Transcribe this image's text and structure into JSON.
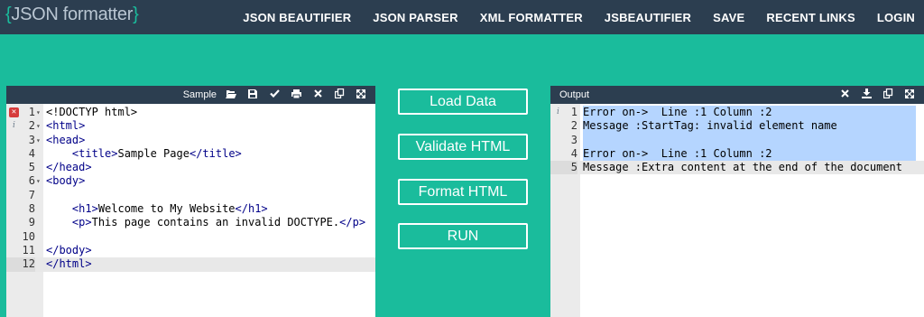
{
  "brand": {
    "open": "{",
    "name": "JSON formatter",
    "close": "}"
  },
  "nav": [
    "JSON BEAUTIFIER",
    "JSON PARSER",
    "XML FORMATTER",
    "JSBEAUTIFIER",
    "SAVE",
    "RECENT LINKS",
    "LOGIN"
  ],
  "left_panel": {
    "title": "Sample",
    "icons": [
      "folder-open-icon",
      "save-icon",
      "check-icon",
      "print-icon",
      "close-icon",
      "copy-icon",
      "expand-icon"
    ],
    "lines": [
      {
        "num": "1",
        "fold": "▾",
        "marker": "err",
        "code": "<!DOCTYP html>"
      },
      {
        "num": "2",
        "fold": "▾",
        "marker": "info",
        "code": "<html>"
      },
      {
        "num": "3",
        "fold": "▾",
        "code": "<head>"
      },
      {
        "num": "4",
        "code": "    <title>Sample Page</title>"
      },
      {
        "num": "5",
        "code": "</head>"
      },
      {
        "num": "6",
        "fold": "▾",
        "code": "<body>"
      },
      {
        "num": "7",
        "code": ""
      },
      {
        "num": "8",
        "code": "    <h1>Welcome to My Website</h1>"
      },
      {
        "num": "9",
        "code": "    <p>This page contains an invalid DOCTYPE.</p>"
      },
      {
        "num": "10",
        "code": ""
      },
      {
        "num": "11",
        "code": "</body>"
      },
      {
        "num": "12",
        "code": "</html>",
        "active": true
      }
    ]
  },
  "buttons": [
    "Load Data",
    "Validate HTML",
    "Format HTML",
    "RUN"
  ],
  "right_panel": {
    "title": "Output",
    "icons": [
      "close-icon",
      "download-icon",
      "copy-icon",
      "expand-icon"
    ],
    "lines": [
      {
        "num": "1",
        "marker": "info",
        "code": "Error on->  Line :1 Column :2"
      },
      {
        "num": "2",
        "code": "Message :StartTag: invalid element name"
      },
      {
        "num": "3",
        "code": ""
      },
      {
        "num": "4",
        "code": "Error on->  Line :1 Column :2"
      },
      {
        "num": "5",
        "code": "Message :Extra content at the end of the document",
        "active": true
      }
    ]
  }
}
